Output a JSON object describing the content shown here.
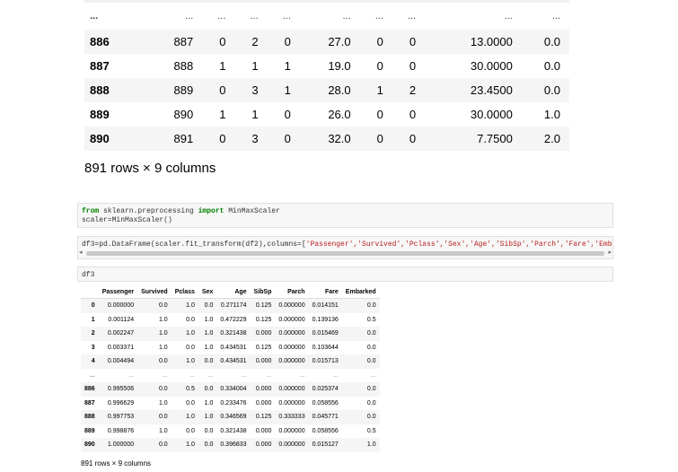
{
  "big_table": {
    "ellipsis": [
      "...",
      "...",
      "...",
      "...",
      "...",
      "...",
      "...",
      "...",
      "...",
      "..."
    ],
    "rows": [
      [
        "886",
        "887",
        "0",
        "2",
        "0",
        "27.0",
        "0",
        "0",
        "13.0000",
        "0.0"
      ],
      [
        "887",
        "888",
        "1",
        "1",
        "1",
        "19.0",
        "0",
        "0",
        "30.0000",
        "0.0"
      ],
      [
        "888",
        "889",
        "0",
        "3",
        "1",
        "28.0",
        "1",
        "2",
        "23.4500",
        "0.0"
      ],
      [
        "889",
        "890",
        "1",
        "1",
        "0",
        "26.0",
        "0",
        "0",
        "30.0000",
        "1.0"
      ],
      [
        "890",
        "891",
        "0",
        "3",
        "0",
        "32.0",
        "0",
        "0",
        "7.7500",
        "2.0"
      ]
    ],
    "caption": "891 rows × 9 columns"
  },
  "cells": {
    "import": {
      "kw_from": "from",
      "module": " sklearn.preprocessing ",
      "kw_import": "import",
      "name": " MinMaxScaler",
      "line2": "scaler=MinMaxScaler()"
    },
    "df_code": {
      "prefix": "df3=pd.DataFrame(scaler.fit_transform(df2),columns=[",
      "cols": "'Passenger','Survived','Pclass','Sex','Age','SibSp','Parch','Fare','Embarked"
    },
    "df3": "df3"
  },
  "small_table": {
    "headers": [
      "",
      "Passenger",
      "Survived",
      "Pclass",
      "Sex",
      "Age",
      "SibSp",
      "Parch",
      "Fare",
      "Embarked"
    ],
    "rows_top": [
      [
        "0",
        "0.000000",
        "0.0",
        "1.0",
        "0.0",
        "0.271174",
        "0.125",
        "0.000000",
        "0.014151",
        "0.0"
      ],
      [
        "1",
        "0.001124",
        "1.0",
        "0.0",
        "1.0",
        "0.472229",
        "0.125",
        "0.000000",
        "0.139136",
        "0.5"
      ],
      [
        "2",
        "0.002247",
        "1.0",
        "1.0",
        "1.0",
        "0.321438",
        "0.000",
        "0.000000",
        "0.015469",
        "0.0"
      ],
      [
        "3",
        "0.003371",
        "1.0",
        "0.0",
        "1.0",
        "0.434531",
        "0.125",
        "0.000000",
        "0.103644",
        "0.0"
      ],
      [
        "4",
        "0.004494",
        "0.0",
        "1.0",
        "0.0",
        "0.434531",
        "0.000",
        "0.000000",
        "0.015713",
        "0.0"
      ]
    ],
    "ellipsis": [
      "...",
      "...",
      "...",
      "...",
      "...",
      "...",
      "...",
      "...",
      "...",
      "..."
    ],
    "rows_bottom": [
      [
        "886",
        "0.995506",
        "0.0",
        "0.5",
        "0.0",
        "0.334004",
        "0.000",
        "0.000000",
        "0.025374",
        "0.0"
      ],
      [
        "887",
        "0.996629",
        "1.0",
        "0.0",
        "1.0",
        "0.233476",
        "0.000",
        "0.000000",
        "0.058556",
        "0.0"
      ],
      [
        "888",
        "0.997753",
        "0.0",
        "1.0",
        "1.0",
        "0.346569",
        "0.125",
        "0.333333",
        "0.045771",
        "0.0"
      ],
      [
        "889",
        "0.998876",
        "1.0",
        "0.0",
        "0.0",
        "0.321438",
        "0.000",
        "0.000000",
        "0.058556",
        "0.5"
      ],
      [
        "890",
        "1.000000",
        "0.0",
        "1.0",
        "0.0",
        "0.396833",
        "0.000",
        "0.000000",
        "0.015127",
        "1.0"
      ]
    ],
    "caption": "891 rows × 9 columns"
  },
  "scrollbar": {
    "left_arrow": "◂",
    "right_arrow": "▸"
  }
}
